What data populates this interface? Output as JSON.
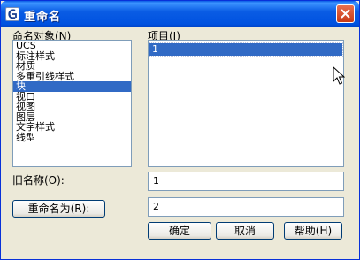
{
  "window": {
    "title": "重命名"
  },
  "labels": {
    "objects": "命名对象(N)",
    "items": "项目(I)",
    "old_name": "旧名称(O):"
  },
  "object_list": [
    {
      "label": "UCS",
      "selected": false
    },
    {
      "label": "标注样式",
      "selected": false
    },
    {
      "label": "材质",
      "selected": false
    },
    {
      "label": "多重引线样式",
      "selected": false
    },
    {
      "label": "块",
      "selected": true
    },
    {
      "label": "视口",
      "selected": false
    },
    {
      "label": "视图",
      "selected": false
    },
    {
      "label": "图层",
      "selected": false
    },
    {
      "label": "文字样式",
      "selected": false
    },
    {
      "label": "线型",
      "selected": false
    }
  ],
  "item_list": [
    {
      "label": "1",
      "selected": true
    }
  ],
  "fields": {
    "old_name_value": "1",
    "new_name_value": "2"
  },
  "buttons": {
    "rename_to": "重命名为(R):",
    "ok": "确定",
    "cancel": "取消",
    "help": "帮助(H)"
  },
  "colors": {
    "titlebar": "#0a5ce4",
    "selection": "#316ac5",
    "dialog_bg": "#ece9d8"
  },
  "icons": {
    "app": "autocad-icon",
    "close": "close-icon",
    "cursor": "mouse-pointer-icon"
  }
}
